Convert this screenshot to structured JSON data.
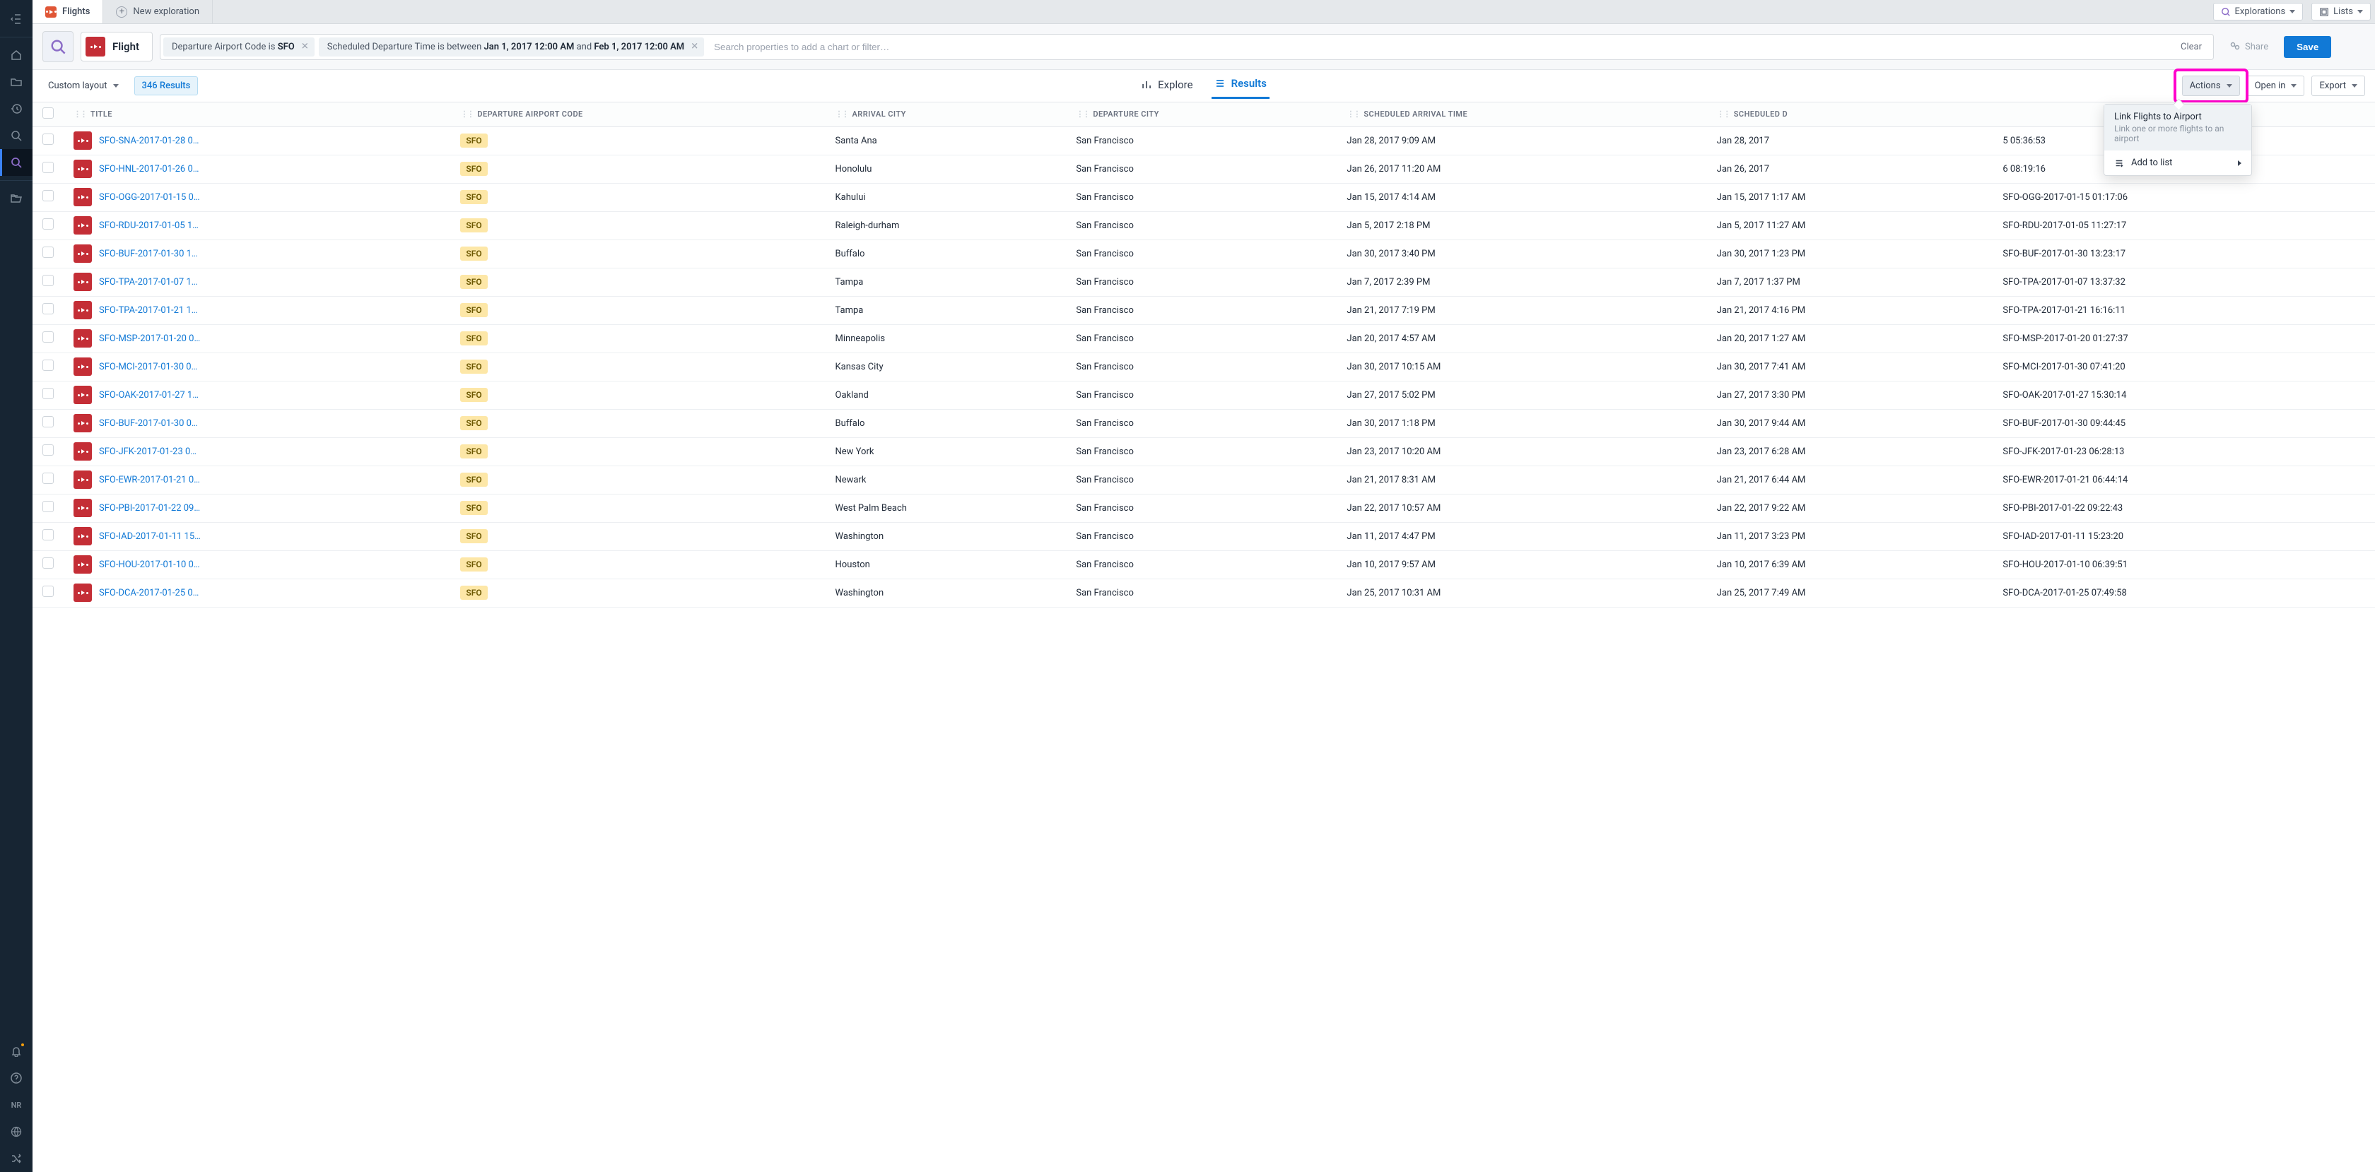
{
  "rail": {
    "user_initials": "NR"
  },
  "tabs": {
    "active": "Flights",
    "new_label": "New exploration"
  },
  "top_right": {
    "explorations": "Explorations",
    "lists": "Lists"
  },
  "filter": {
    "entity_label": "Flight",
    "pill1_prefix": "Departure Airport Code is ",
    "pill1_value": "SFO",
    "pill2_prefix": "Scheduled Departure Time is between ",
    "pill2_v1": "Jan 1, 2017 12:00 AM",
    "pill2_mid": " and ",
    "pill2_v2": "Feb 1, 2017 12:00 AM",
    "search_placeholder": "Search properties to add a chart or filter…",
    "clear": "Clear",
    "share": "Share",
    "save": "Save"
  },
  "toolbar": {
    "layout": "Custom layout",
    "results_count": "346 Results",
    "explore": "Explore",
    "results": "Results",
    "actions": "Actions",
    "open_in": "Open in",
    "export": "Export"
  },
  "popover": {
    "link_title": "Link Flights to Airport",
    "link_sub": "Link one or more flights to an airport",
    "add_to_list": "Add to list"
  },
  "columns": {
    "title": "TITLE",
    "dep_code": "DEPARTURE AIRPORT CODE",
    "arr_city": "ARRIVAL CITY",
    "dep_city": "DEPARTURE CITY",
    "sched_arr": "SCHEDULED ARRIVAL TIME",
    "sched_dep_short": "SCHEDULED D",
    "flight_id": ""
  },
  "rows": [
    {
      "title": "SFO-SNA-2017-01-28 0…",
      "code": "SFO",
      "arr": "Santa Ana",
      "dep": "San Francisco",
      "sa": "Jan 28, 2017 9:09 AM",
      "sd": "Jan 28, 2017",
      "fid": "5 05:36:53"
    },
    {
      "title": "SFO-HNL-2017-01-26 0…",
      "code": "SFO",
      "arr": "Honolulu",
      "dep": "San Francisco",
      "sa": "Jan 26, 2017 11:20 AM",
      "sd": "Jan 26, 2017",
      "fid": "6 08:19:16"
    },
    {
      "title": "SFO-OGG-2017-01-15 0…",
      "code": "SFO",
      "arr": "Kahului",
      "dep": "San Francisco",
      "sa": "Jan 15, 2017 4:14 AM",
      "sd": "Jan 15, 2017 1:17 AM",
      "fid": "SFO-OGG-2017-01-15 01:17:06"
    },
    {
      "title": "SFO-RDU-2017-01-05 1…",
      "code": "SFO",
      "arr": "Raleigh-durham",
      "dep": "San Francisco",
      "sa": "Jan 5, 2017 2:18 PM",
      "sd": "Jan 5, 2017 11:27 AM",
      "fid": "SFO-RDU-2017-01-05 11:27:17"
    },
    {
      "title": "SFO-BUF-2017-01-30 1…",
      "code": "SFO",
      "arr": "Buffalo",
      "dep": "San Francisco",
      "sa": "Jan 30, 2017 3:40 PM",
      "sd": "Jan 30, 2017 1:23 PM",
      "fid": "SFO-BUF-2017-01-30 13:23:17"
    },
    {
      "title": "SFO-TPA-2017-01-07 1…",
      "code": "SFO",
      "arr": "Tampa",
      "dep": "San Francisco",
      "sa": "Jan 7, 2017 2:39 PM",
      "sd": "Jan 7, 2017 1:37 PM",
      "fid": "SFO-TPA-2017-01-07 13:37:32"
    },
    {
      "title": "SFO-TPA-2017-01-21 1…",
      "code": "SFO",
      "arr": "Tampa",
      "dep": "San Francisco",
      "sa": "Jan 21, 2017 7:19 PM",
      "sd": "Jan 21, 2017 4:16 PM",
      "fid": "SFO-TPA-2017-01-21 16:16:11"
    },
    {
      "title": "SFO-MSP-2017-01-20 0…",
      "code": "SFO",
      "arr": "Minneapolis",
      "dep": "San Francisco",
      "sa": "Jan 20, 2017 4:57 AM",
      "sd": "Jan 20, 2017 1:27 AM",
      "fid": "SFO-MSP-2017-01-20 01:27:37"
    },
    {
      "title": "SFO-MCI-2017-01-30 0…",
      "code": "SFO",
      "arr": "Kansas City",
      "dep": "San Francisco",
      "sa": "Jan 30, 2017 10:15 AM",
      "sd": "Jan 30, 2017 7:41 AM",
      "fid": "SFO-MCI-2017-01-30 07:41:20"
    },
    {
      "title": "SFO-OAK-2017-01-27 1…",
      "code": "SFO",
      "arr": "Oakland",
      "dep": "San Francisco",
      "sa": "Jan 27, 2017 5:02 PM",
      "sd": "Jan 27, 2017 3:30 PM",
      "fid": "SFO-OAK-2017-01-27 15:30:14"
    },
    {
      "title": "SFO-BUF-2017-01-30 0…",
      "code": "SFO",
      "arr": "Buffalo",
      "dep": "San Francisco",
      "sa": "Jan 30, 2017 1:18 PM",
      "sd": "Jan 30, 2017 9:44 AM",
      "fid": "SFO-BUF-2017-01-30 09:44:45"
    },
    {
      "title": "SFO-JFK-2017-01-23 0…",
      "code": "SFO",
      "arr": "New York",
      "dep": "San Francisco",
      "sa": "Jan 23, 2017 10:20 AM",
      "sd": "Jan 23, 2017 6:28 AM",
      "fid": "SFO-JFK-2017-01-23 06:28:13"
    },
    {
      "title": "SFO-EWR-2017-01-21 0…",
      "code": "SFO",
      "arr": "Newark",
      "dep": "San Francisco",
      "sa": "Jan 21, 2017 8:31 AM",
      "sd": "Jan 21, 2017 6:44 AM",
      "fid": "SFO-EWR-2017-01-21 06:44:14"
    },
    {
      "title": "SFO-PBI-2017-01-22 09…",
      "code": "SFO",
      "arr": "West Palm Beach",
      "dep": "San Francisco",
      "sa": "Jan 22, 2017 10:57 AM",
      "sd": "Jan 22, 2017 9:22 AM",
      "fid": "SFO-PBI-2017-01-22 09:22:43"
    },
    {
      "title": "SFO-IAD-2017-01-11 15…",
      "code": "SFO",
      "arr": "Washington",
      "dep": "San Francisco",
      "sa": "Jan 11, 2017 4:47 PM",
      "sd": "Jan 11, 2017 3:23 PM",
      "fid": "SFO-IAD-2017-01-11 15:23:20"
    },
    {
      "title": "SFO-HOU-2017-01-10 0…",
      "code": "SFO",
      "arr": "Houston",
      "dep": "San Francisco",
      "sa": "Jan 10, 2017 9:57 AM",
      "sd": "Jan 10, 2017 6:39 AM",
      "fid": "SFO-HOU-2017-01-10 06:39:51"
    },
    {
      "title": "SFO-DCA-2017-01-25 0…",
      "code": "SFO",
      "arr": "Washington",
      "dep": "San Francisco",
      "sa": "Jan 25, 2017 10:31 AM",
      "sd": "Jan 25, 2017 7:49 AM",
      "fid": "SFO-DCA-2017-01-25 07:49:58"
    }
  ]
}
